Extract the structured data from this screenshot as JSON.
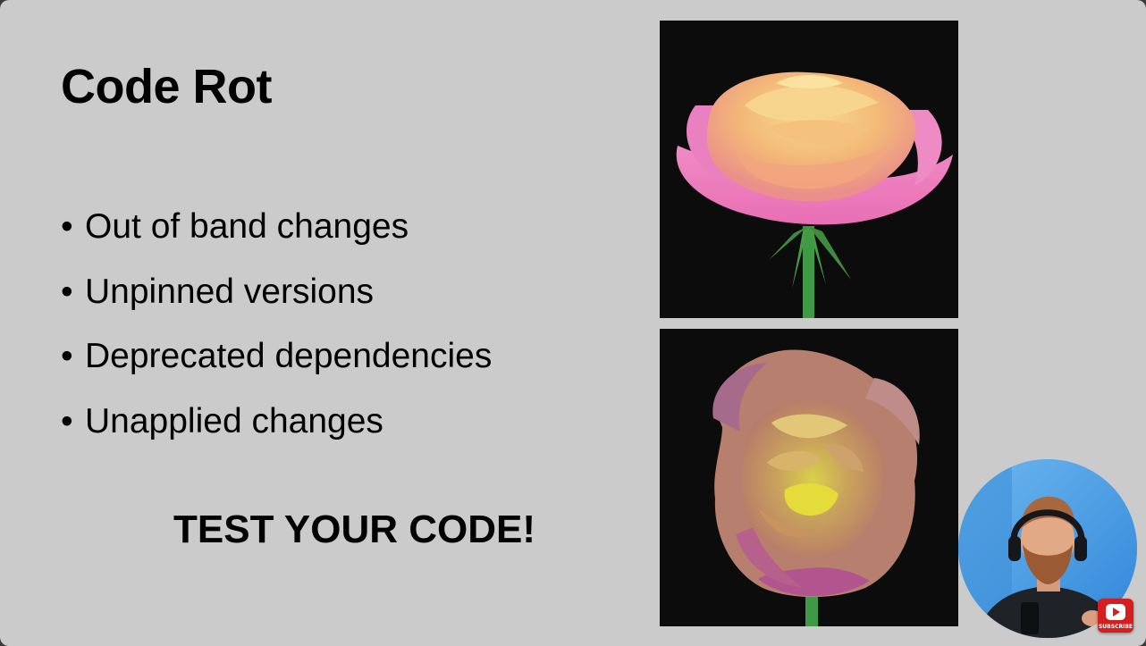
{
  "slide": {
    "title": "Code Rot",
    "bullets": [
      "Out of band changes",
      "Unpinned versions",
      "Deprecated dependencies",
      "Unapplied changes"
    ],
    "bullet_glyph": "•",
    "callout": "TEST YOUR CODE!"
  },
  "images": {
    "top": "fresh-rose-photo",
    "bottom": "wilted-rose-photo"
  },
  "overlay": {
    "webcam": "presenter-webcam",
    "subscribe_label": "SUBSCRIBE"
  },
  "colors": {
    "slide_background": "#cbcbcb",
    "text": "#000000",
    "photo_background": "#0c0c0c",
    "subscribe_red": "#d31f1f"
  }
}
